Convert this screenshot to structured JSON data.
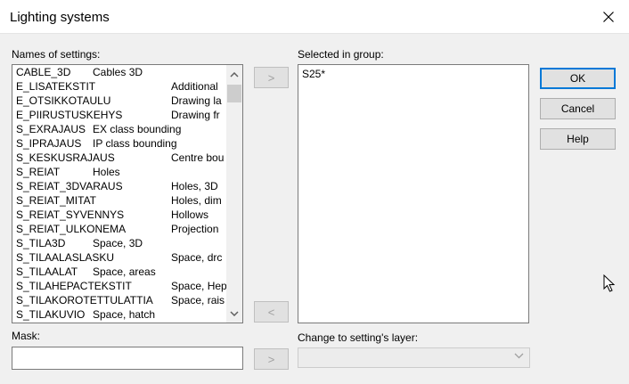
{
  "window": {
    "title": "Lighting systems"
  },
  "labels": {
    "names_of_settings": "Names of settings:",
    "selected_in_group": "Selected in group:",
    "mask": "Mask:",
    "change_layer": "Change to setting's layer:"
  },
  "settings_list": [
    {
      "name": "CABLE_3D",
      "desc": "Cables 3D"
    },
    {
      "name": "E_LISATEKSTIT",
      "desc": "Additional"
    },
    {
      "name": "E_OTSIKKOTAULU",
      "desc": "Drawing la"
    },
    {
      "name": "E_PIIRUSTUSKEHYS",
      "desc": "Drawing fr"
    },
    {
      "name": "S_EXRAJAUS",
      "desc": "EX class bounding"
    },
    {
      "name": "S_IPRAJAUS",
      "desc": "IP class bounding"
    },
    {
      "name": "S_KESKUSRAJAUS",
      "desc": "Centre bou"
    },
    {
      "name": "S_REIAT",
      "desc": "Holes"
    },
    {
      "name": "S_REIAT_3DVARAUS",
      "desc": "Holes, 3D"
    },
    {
      "name": "S_REIAT_MITAT",
      "desc": "Holes, dim"
    },
    {
      "name": "S_REIAT_SYVENNYS",
      "desc": "Hollows"
    },
    {
      "name": "S_REIAT_ULKONEMA",
      "desc": "Projection"
    },
    {
      "name": "S_TILA3D",
      "desc": "Space, 3D"
    },
    {
      "name": "S_TILAALASLASKU",
      "desc": "Space, drc"
    },
    {
      "name": "S_TILAALAT",
      "desc": "Space, areas"
    },
    {
      "name": "S_TILAHEPACTEKSTIT",
      "desc": "Space, Hep"
    },
    {
      "name": "S_TILAKOROTETTULATTIA",
      "desc": "Space, rais"
    },
    {
      "name": "S_TILAKUVIO",
      "desc": "Space, hatch"
    }
  ],
  "selected_group": [
    "S25*"
  ],
  "buttons": {
    "ok": "OK",
    "cancel": "Cancel",
    "help": "Help",
    "add": ">",
    "remove": "<",
    "mask_add": ">"
  },
  "mask": {
    "value": ""
  },
  "layer_combo": {
    "value": ""
  }
}
